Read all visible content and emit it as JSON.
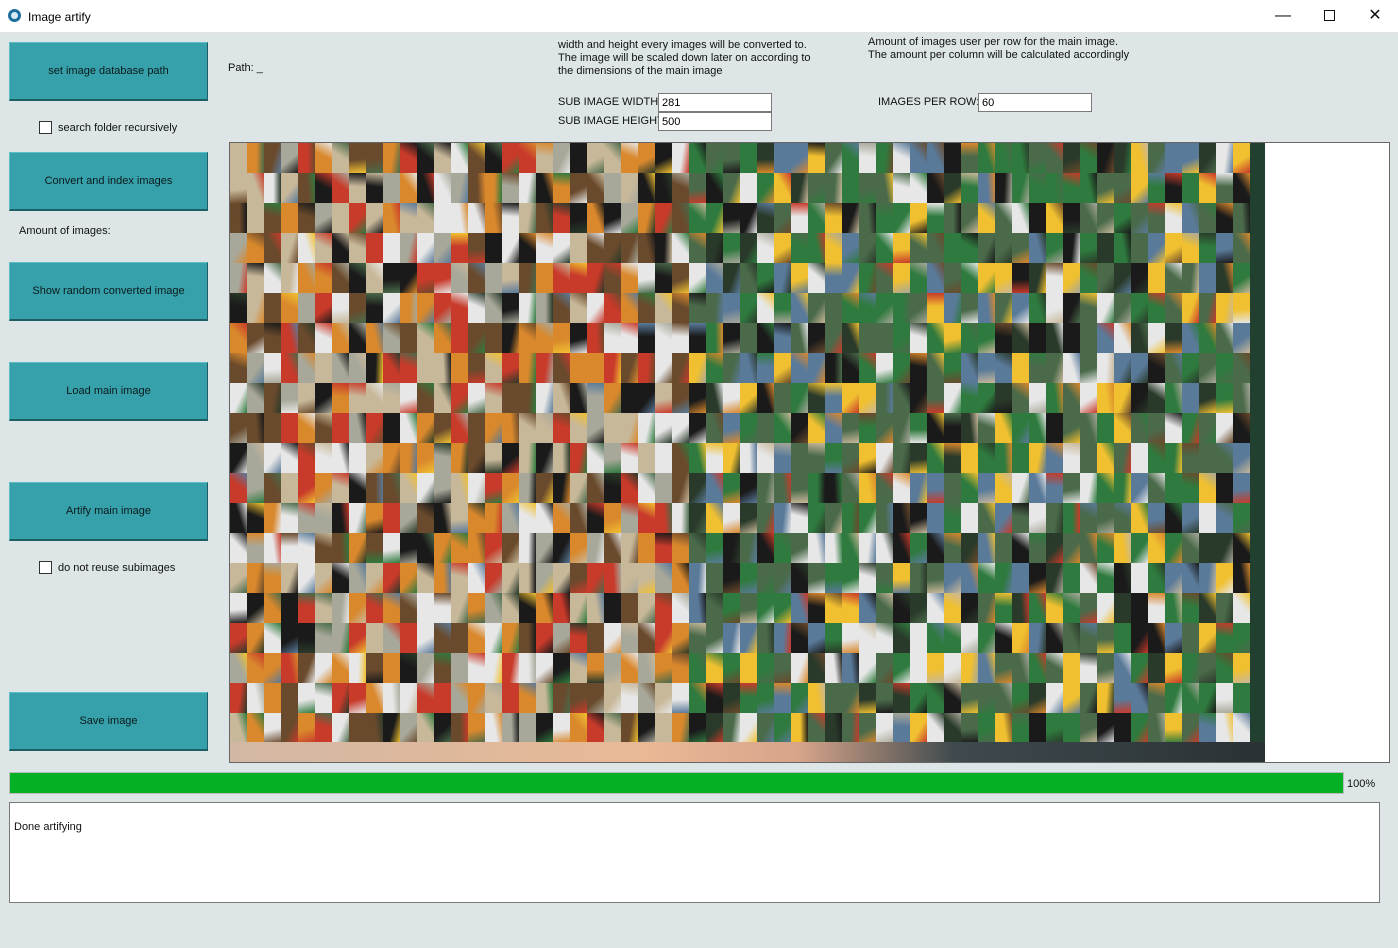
{
  "window": {
    "title": "Image artify",
    "minimize": "—",
    "close": "✕"
  },
  "sidebar": {
    "set_path_button": "set image database path",
    "search_recursive_label": "search folder recursively",
    "convert_button": "Convert and index images",
    "amount_label": "Amount of images:",
    "show_random_button": "Show random converted image",
    "load_main_button": "Load main image",
    "artify_button": "Artify main image",
    "no_reuse_label": "do not reuse subimages",
    "save_button": "Save image"
  },
  "settings": {
    "path_label": "Path: _",
    "size_description": "width and height every images will be converted to.\nThe image will be scaled down later on according to\nthe dimensions of the main image",
    "row_description": "Amount of images user per row for the main image.\nThe amount per column will be calculated accordingly",
    "sub_width_label": "SUB IMAGE WIDTH:",
    "sub_width_value": "281",
    "sub_height_label": "SUB IMAGE HEIGHT:",
    "sub_height_value": "500",
    "per_row_label": "IMAGES PER ROW:",
    "per_row_value": "60"
  },
  "mosaic": {
    "description": "mosaic preview",
    "palette": [
      "#6a4a2c",
      "#d9882c",
      "#a8a89a",
      "#1a1a1a",
      "#2f7a3e",
      "#4a6a4a",
      "#c8b89a",
      "#c83a2a",
      "#e7e7e7",
      "#2a3a2a",
      "#5a7a9a",
      "#f0c030"
    ]
  },
  "progress": {
    "percent": 100,
    "label": "100%",
    "color": "#06b025"
  },
  "log": {
    "text": "Done artifying"
  }
}
